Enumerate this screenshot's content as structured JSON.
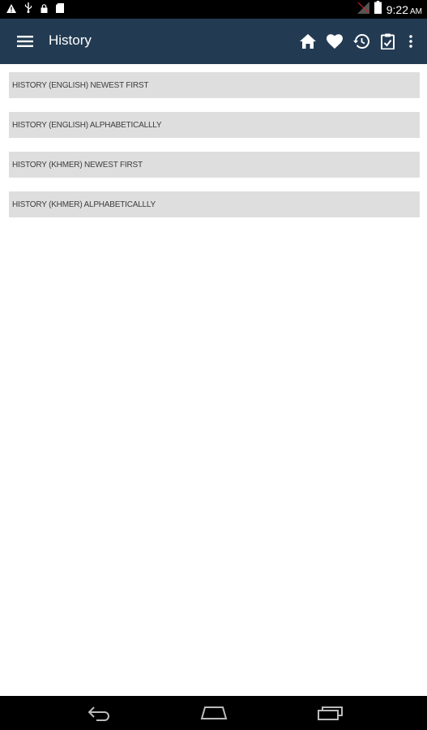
{
  "status_bar": {
    "time": "9:22",
    "ampm": "AM",
    "icons": [
      "warning-icon",
      "usb-icon",
      "lock-icon",
      "sd-card-icon",
      "no-signal-icon",
      "battery-icon"
    ]
  },
  "app_bar": {
    "title": "History",
    "background": "#233b52",
    "actions": [
      "home-icon",
      "heart-icon",
      "history-icon",
      "clipboard-icon",
      "more-vert-icon"
    ]
  },
  "history_options": [
    {
      "label": "HISTORY (ENGLISH) NEWEST FIRST"
    },
    {
      "label": "HISTORY (ENGLISH) ALPHABETICALLLY"
    },
    {
      "label": "HISTORY (KHMER) NEWEST FIRST"
    },
    {
      "label": "HISTORY (KHMER) ALPHABETICALLLY"
    }
  ],
  "nav_bar": {
    "buttons": [
      "back-icon",
      "home-nav-icon",
      "recents-icon"
    ]
  }
}
